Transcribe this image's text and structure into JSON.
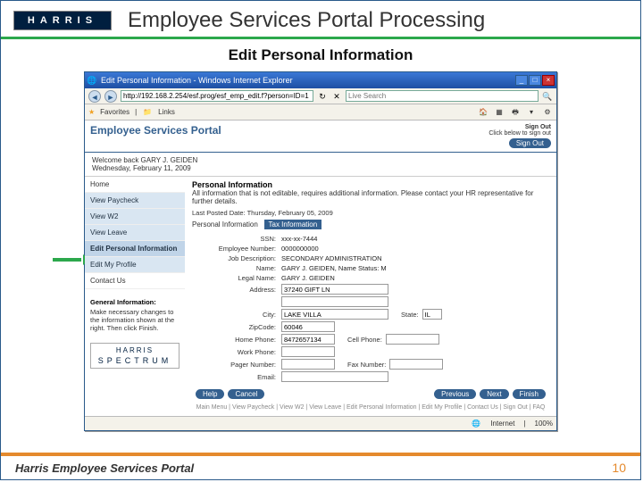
{
  "slide": {
    "logo_text": "HARRIS",
    "title": "Employee Services Portal Processing",
    "subtitle": "Edit Personal Information",
    "footer_title": "Harris Employee Services Portal",
    "page_number": "10"
  },
  "browser": {
    "window_title": "Edit Personal Information - Windows Internet Explorer",
    "url": "http://192.168.2.254/esf.prog/esf_emp_edit.f?person=ID=1",
    "search_placeholder": "Live Search",
    "toolbar": {
      "favorites": "Favorites",
      "links": "Links"
    },
    "status": {
      "zone": "Internet",
      "zoom": "100%"
    }
  },
  "portal": {
    "header_title": "Employee Services Portal",
    "signout_label": "Sign Out",
    "signout_hint": "Click below to sign out",
    "welcome_name": "Welcome back GARY J. GEIDEN",
    "welcome_date": "Wednesday, February 11, 2009",
    "nav": {
      "home": "Home",
      "paycheck": "View Paycheck",
      "w2": "View W2",
      "leave": "View Leave",
      "edit_personal": "Edit Personal Information",
      "edit_profile": "Edit My Profile",
      "contact": "Contact Us"
    },
    "geninfo": {
      "title": "General Information:",
      "body": "Make necessary changes to the information shown at the right. Then click Finish."
    },
    "spectrum": {
      "top": "HARRIS",
      "bottom": "SPECTRUM"
    },
    "section": {
      "title": "Personal Information",
      "desc": "All information that is not editable, requires additional information. Please contact your HR representative for further details.",
      "last_posted_label": "Last Posted Date:",
      "last_posted_value": "Thursday, February 05, 2009",
      "tabs": {
        "personal": "Personal Information",
        "tax": "Tax Information"
      }
    },
    "form": {
      "ssn": {
        "label": "SSN:",
        "value": "xxx-xx-7444"
      },
      "emp_num": {
        "label": "Employee Number:",
        "value": "0000000000"
      },
      "job_desc": {
        "label": "Job Description:",
        "value": "SECONDARY ADMINISTRATION"
      },
      "name": {
        "label": "Name:",
        "value": "GARY J. GEIDEN, Name Status: M"
      },
      "legal_name": {
        "label": "Legal Name:",
        "value": "GARY J. GEIDEN"
      },
      "address": {
        "label": "Address:",
        "value": "37240 GIFT LN"
      },
      "city": {
        "label": "City:",
        "value": "LAKE VILLA"
      },
      "state": {
        "label": "State:",
        "value": "IL"
      },
      "zip": {
        "label": "ZipCode:",
        "value": "60046"
      },
      "home_phone": {
        "label": "Home Phone:",
        "value": "8472657134"
      },
      "cell_phone": {
        "label": "Cell Phone:",
        "value": ""
      },
      "work_phone": {
        "label": "Work Phone:",
        "value": ""
      },
      "pager": {
        "label": "Pager Number:",
        "value": ""
      },
      "fax": {
        "label": "Fax Number:",
        "value": ""
      },
      "email": {
        "label": "Email:",
        "value": ""
      }
    },
    "buttons": {
      "help": "Help",
      "cancel": "Cancel",
      "previous": "Previous",
      "next": "Next",
      "finish": "Finish"
    },
    "footer_links": "Main Menu | View Paycheck | View W2 | View Leave | Edit Personal Information | Edit My Profile | Contact Us | Sign Out | FAQ"
  }
}
